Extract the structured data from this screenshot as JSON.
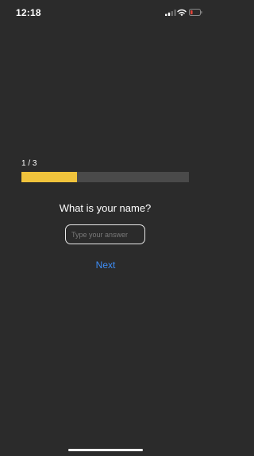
{
  "status_bar": {
    "time": "12:18",
    "battery_color": "#e0453a"
  },
  "quiz": {
    "progress_label": "1 / 3",
    "progress_fraction": 0.333,
    "progress_color": "#f0c33c",
    "question": "What is your name?",
    "answer_value": "",
    "answer_placeholder": "Type your answer",
    "next_label": "Next",
    "accent_color": "#3e8ef7"
  }
}
